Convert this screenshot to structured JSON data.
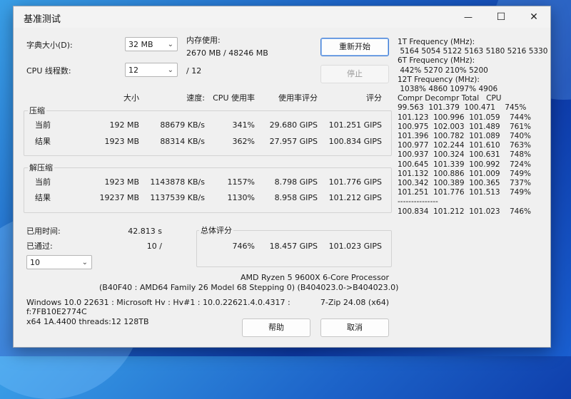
{
  "window": {
    "title": "基准测试",
    "minimize_glyph": "—",
    "maximize_glyph": "☐",
    "close_glyph": "✕"
  },
  "controls": {
    "dict_label": "字典大小(D):",
    "dict_value": "32 MB",
    "threads_label": "CPU 线程数:",
    "threads_value": "12",
    "threads_total": "/ 12",
    "mem_label": "内存使用:",
    "mem_value": "2670 MB / 48246 MB",
    "restart_button": "重新开始",
    "stop_button": "停止"
  },
  "table": {
    "headers": {
      "size": "大小",
      "speed": "速度:",
      "cpu": "CPU 使用率",
      "rating_per_usage": "使用率评分",
      "rating": "评分"
    },
    "compress": {
      "title": "压缩",
      "rows": [
        {
          "label": "当前",
          "size": "192 MB",
          "speed": "88679 KB/s",
          "cpu": "341%",
          "rpu": "29.680 GIPS",
          "rating": "101.251 GIPS"
        },
        {
          "label": "结果",
          "size": "1923 MB",
          "speed": "88314 KB/s",
          "cpu": "362%",
          "rpu": "27.957 GIPS",
          "rating": "100.834 GIPS"
        }
      ]
    },
    "decompress": {
      "title": "解压缩",
      "rows": [
        {
          "label": "当前",
          "size": "1923 MB",
          "speed": "1143878 KB/s",
          "cpu": "1157%",
          "rpu": "8.798 GIPS",
          "rating": "101.776 GIPS"
        },
        {
          "label": "结果",
          "size": "19237 MB",
          "speed": "1137539 KB/s",
          "cpu": "1130%",
          "rpu": "8.958 GIPS",
          "rating": "101.212 GIPS"
        }
      ]
    }
  },
  "status": {
    "elapsed_label": "已用时间:",
    "elapsed_value": "42.813 s",
    "passed_label": "已通过:",
    "passed_value": "10 /",
    "passes_select": "10"
  },
  "total": {
    "title": "总体评分",
    "cpu": "746%",
    "rpu": "18.457 GIPS",
    "rating": "101.023 GIPS"
  },
  "cpu_info": {
    "line1": "AMD Ryzen 5 9600X 6-Core Processor",
    "line2": "(B40F40 : AMD64 Family 26 Model 68 Stepping 0) (B404023.0->B404023.0)"
  },
  "sys_info": {
    "line1": "Windows 10.0 22631 : Microsoft Hv : Hv#1 : 10.0.22621.4.0.4317 :",
    "line2": "f:7FB10E2774C",
    "line3": "x64 1A.4400 threads:12 128TB",
    "version": "7-Zip 24.08 (x64)"
  },
  "buttons": {
    "help": "帮助",
    "cancel": "取消"
  },
  "freq_log": {
    "lines": [
      "1T Frequency (MHz):",
      " 5164 5054 5122 5163 5180 5216 5330",
      "6T Frequency (MHz):",
      " 442% 5270 210% 5200",
      "12T Frequency (MHz):",
      " 1038% 4860 1097% 4906",
      "Compr Decompr Total   CPU",
      "99.563  101.379  100.471    745%",
      "101.123  100.996  101.059    744%",
      "100.975  102.003  101.489    761%",
      "101.396  100.782  101.089    740%",
      "100.977  102.244  101.610    763%",
      "100.937  100.324  100.631    748%",
      "100.645  101.339  100.992    724%",
      "101.132  100.886  101.009    749%",
      "100.342  100.389  100.365    737%",
      "101.251  101.776  101.513    749%",
      "---------------",
      "100.834  101.212  101.023    746%"
    ]
  }
}
